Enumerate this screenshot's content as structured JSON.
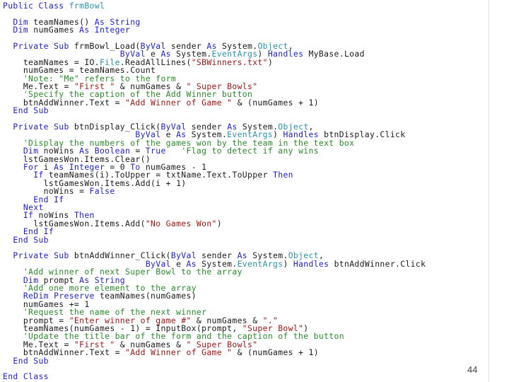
{
  "colors": {
    "keyword": "#1f1fd0",
    "type": "#2b91af",
    "comment": "#2a8a2a",
    "string": "#a31515",
    "text": "#1a1a1a"
  },
  "code_lines": [
    [
      [
        "k",
        "Public Class "
      ],
      [
        "t",
        "frmBowl"
      ]
    ],
    [],
    [
      [
        "p",
        "  "
      ],
      [
        "k",
        "Dim"
      ],
      [
        "p",
        " teamNames() "
      ],
      [
        "k",
        "As String"
      ]
    ],
    [
      [
        "p",
        "  "
      ],
      [
        "k",
        "Dim"
      ],
      [
        "p",
        " numGames "
      ],
      [
        "k",
        "As Integer"
      ]
    ],
    [],
    [
      [
        "p",
        "  "
      ],
      [
        "k",
        "Private Sub"
      ],
      [
        "p",
        " frmBowl_Load("
      ],
      [
        "k",
        "ByVal"
      ],
      [
        "p",
        " sender "
      ],
      [
        "k",
        "As"
      ],
      [
        "p",
        " System."
      ],
      [
        "t",
        "Object"
      ],
      [
        "p",
        ","
      ]
    ],
    [
      [
        "p",
        "                       "
      ],
      [
        "k",
        "ByVal"
      ],
      [
        "p",
        " e "
      ],
      [
        "k",
        "As"
      ],
      [
        "p",
        " System."
      ],
      [
        "t",
        "EventArgs"
      ],
      [
        "p",
        ") "
      ],
      [
        "k",
        "Handles"
      ],
      [
        "p",
        " MyBase.Load"
      ]
    ],
    [
      [
        "p",
        "    teamNames = IO."
      ],
      [
        "t",
        "File"
      ],
      [
        "p",
        ".ReadAllLines("
      ],
      [
        "s",
        "\"SBWinners.txt\""
      ],
      [
        "p",
        ")"
      ]
    ],
    [
      [
        "p",
        "    numGames = teamNames.Count"
      ]
    ],
    [
      [
        "p",
        "    "
      ],
      [
        "c",
        "'Note: \"Me\" refers to the form"
      ]
    ],
    [
      [
        "p",
        "    Me.Text = "
      ],
      [
        "s",
        "\"First \""
      ],
      [
        "p",
        " & numGames & "
      ],
      [
        "s",
        "\" Super Bowls\""
      ]
    ],
    [
      [
        "p",
        "    "
      ],
      [
        "c",
        "'Specify the caption of the Add Winner button"
      ]
    ],
    [
      [
        "p",
        "    btnAddWinner.Text = "
      ],
      [
        "s",
        "\"Add Winner of Game \""
      ],
      [
        "p",
        " & (numGames + 1)"
      ]
    ],
    [
      [
        "p",
        "  "
      ],
      [
        "k",
        "End Sub"
      ]
    ],
    [],
    [
      [
        "p",
        "  "
      ],
      [
        "k",
        "Private Sub"
      ],
      [
        "p",
        " btnDisplay_Click("
      ],
      [
        "k",
        "ByVal"
      ],
      [
        "p",
        " sender "
      ],
      [
        "k",
        "As"
      ],
      [
        "p",
        " System."
      ],
      [
        "t",
        "Object"
      ],
      [
        "p",
        ","
      ]
    ],
    [
      [
        "p",
        "                          "
      ],
      [
        "k",
        "ByVal"
      ],
      [
        "p",
        " e "
      ],
      [
        "k",
        "As"
      ],
      [
        "p",
        " System."
      ],
      [
        "t",
        "EventArgs"
      ],
      [
        "p",
        ") "
      ],
      [
        "k",
        "Handles"
      ],
      [
        "p",
        " btnDisplay.Click"
      ]
    ],
    [
      [
        "p",
        "    "
      ],
      [
        "c",
        "'Display the numbers of the games won by the team in the text box"
      ]
    ],
    [
      [
        "p",
        "    "
      ],
      [
        "k",
        "Dim"
      ],
      [
        "p",
        " noWins "
      ],
      [
        "k",
        "As Boolean"
      ],
      [
        "p",
        " = "
      ],
      [
        "k",
        "True"
      ],
      [
        "p",
        "   "
      ],
      [
        "c",
        "'Flag to detect if any wins"
      ]
    ],
    [
      [
        "p",
        "    lstGamesWon.Items.Clear()"
      ]
    ],
    [
      [
        "p",
        "    "
      ],
      [
        "k",
        "For"
      ],
      [
        "p",
        " i "
      ],
      [
        "k",
        "As Integer"
      ],
      [
        "p",
        " = 0 "
      ],
      [
        "k",
        "To"
      ],
      [
        "p",
        " numGames - 1"
      ]
    ],
    [
      [
        "p",
        "      "
      ],
      [
        "k",
        "If"
      ],
      [
        "p",
        " teamNames(i).ToUpper = txtName.Text.ToUpper "
      ],
      [
        "k",
        "Then"
      ]
    ],
    [
      [
        "p",
        "        lstGamesWon.Items.Add(i + 1)"
      ]
    ],
    [
      [
        "p",
        "        noWins = "
      ],
      [
        "k",
        "False"
      ]
    ],
    [
      [
        "p",
        "      "
      ],
      [
        "k",
        "End If"
      ]
    ],
    [
      [
        "p",
        "    "
      ],
      [
        "k",
        "Next"
      ]
    ],
    [
      [
        "p",
        "    "
      ],
      [
        "k",
        "If"
      ],
      [
        "p",
        " noWins "
      ],
      [
        "k",
        "Then"
      ]
    ],
    [
      [
        "p",
        "      lstGamesWon.Items.Add("
      ],
      [
        "s",
        "\"No Games Won\""
      ],
      [
        "p",
        ")"
      ]
    ],
    [
      [
        "p",
        "    "
      ],
      [
        "k",
        "End If"
      ]
    ],
    [
      [
        "p",
        "  "
      ],
      [
        "k",
        "End Sub"
      ]
    ],
    [],
    [
      [
        "p",
        "  "
      ],
      [
        "k",
        "Private Sub"
      ],
      [
        "p",
        " btnAddWinner_Click("
      ],
      [
        "k",
        "ByVal"
      ],
      [
        "p",
        " sender "
      ],
      [
        "k",
        "As"
      ],
      [
        "p",
        " System."
      ],
      [
        "t",
        "Object"
      ],
      [
        "p",
        ","
      ]
    ],
    [
      [
        "p",
        "                            "
      ],
      [
        "k",
        "ByVal"
      ],
      [
        "p",
        " e "
      ],
      [
        "k",
        "As"
      ],
      [
        "p",
        " System."
      ],
      [
        "t",
        "EventArgs"
      ],
      [
        "p",
        ") "
      ],
      [
        "k",
        "Handles"
      ],
      [
        "p",
        " btnAddWinner.Click"
      ]
    ],
    [
      [
        "p",
        "    "
      ],
      [
        "c",
        "'Add winner of next Super Bowl to the array"
      ]
    ],
    [
      [
        "p",
        "    "
      ],
      [
        "k",
        "Dim"
      ],
      [
        "p",
        " prompt "
      ],
      [
        "k",
        "As String"
      ]
    ],
    [
      [
        "p",
        "    "
      ],
      [
        "c",
        "'Add one more element to the array"
      ]
    ],
    [
      [
        "p",
        "    "
      ],
      [
        "k",
        "ReDim Preserve"
      ],
      [
        "p",
        " teamNames(numGames)"
      ]
    ],
    [
      [
        "p",
        "    numGames += 1"
      ]
    ],
    [
      [
        "p",
        "    "
      ],
      [
        "c",
        "'Request the name of the next winner"
      ]
    ],
    [
      [
        "p",
        "    prompt = "
      ],
      [
        "s",
        "\"Enter winner of game #\""
      ],
      [
        "p",
        " & numGames & "
      ],
      [
        "s",
        "\".\""
      ]
    ],
    [
      [
        "p",
        "    teamNames(numGames - 1) = InputBox(prompt, "
      ],
      [
        "s",
        "\"Super Bowl\""
      ],
      [
        "p",
        ")"
      ]
    ],
    [
      [
        "p",
        "    "
      ],
      [
        "c",
        "'Update the title bar of the form and the caption of the button"
      ]
    ],
    [
      [
        "p",
        "    Me.Text = "
      ],
      [
        "s",
        "\"First \""
      ],
      [
        "p",
        " & numGames & "
      ],
      [
        "s",
        "\" Super Bowls\""
      ]
    ],
    [
      [
        "p",
        "    btnAddWinner.Text = "
      ],
      [
        "s",
        "\"Add Winner of Game \""
      ],
      [
        "p",
        " & (numGames + 1)"
      ]
    ],
    [
      [
        "p",
        "  "
      ],
      [
        "k",
        "End Sub"
      ]
    ],
    [],
    [
      [
        "k",
        "End Class"
      ]
    ]
  ],
  "page_number": "44"
}
